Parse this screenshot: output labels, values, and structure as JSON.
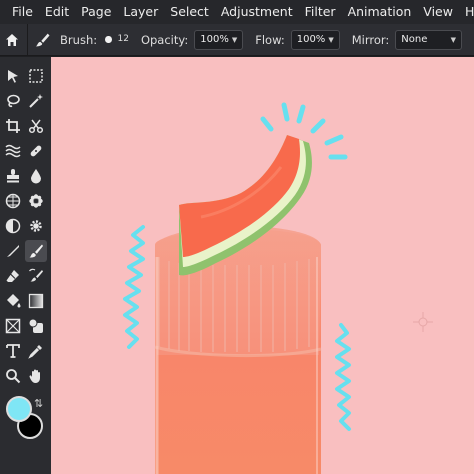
{
  "menu": [
    "File",
    "Edit",
    "Page",
    "Layer",
    "Select",
    "Adjustment",
    "Filter",
    "Animation",
    "View",
    "He"
  ],
  "options": {
    "brush_label": "Brush:",
    "brush_size": "12",
    "opacity_label": "Opacity:",
    "opacity_value": "100%",
    "flow_label": "Flow:",
    "flow_value": "100%",
    "mirror_label": "Mirror:",
    "mirror_value": "None"
  },
  "tools": [
    "move-tool",
    "marquee-tool",
    "lasso-tool",
    "magic-wand-tool",
    "crop-tool",
    "cut-tool",
    "liquify-tool",
    "healing-tool",
    "stamp-tool",
    "drop-tool",
    "pattern-tool",
    "blob-tool",
    "dodge-tool",
    "sponge-tool",
    "pencil-tool",
    "brush-tool",
    "eraser-tool",
    "replace-tool",
    "fill-tool",
    "gradient-tool",
    "frame-tool",
    "shape-tool",
    "text-tool",
    "eyedropper-tool",
    "zoom-tool",
    "hand-tool"
  ],
  "active_tool": "brush-tool",
  "colors": {
    "foreground": "#7fe6f5",
    "background": "#000000",
    "canvas_bg": "#f9bfc0",
    "accent_squiggle": "#66e0ef"
  }
}
